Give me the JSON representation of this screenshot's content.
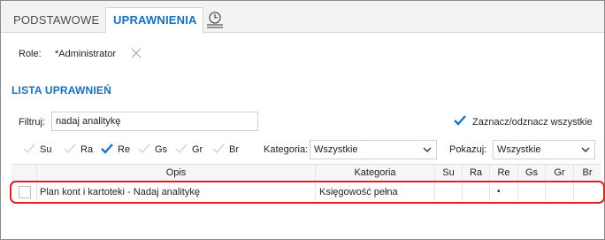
{
  "tabs": [
    {
      "label": "PODSTAWOWE",
      "active": false
    },
    {
      "label": "UPRAWNIENIA",
      "active": true
    },
    {
      "label": "",
      "icon": "history-icon"
    }
  ],
  "role": {
    "label": "Role:",
    "value": "*Administrator",
    "clear_icon": "close-icon"
  },
  "section_title": "LISTA UPRAWNIEŃ",
  "filter": {
    "label": "Filtruj:",
    "value": "nadaj analitykę"
  },
  "toggle_all": {
    "label": "Zaznacz/odznacz wszystkie",
    "checked": true
  },
  "permissions": [
    {
      "code": "Su",
      "checked": false
    },
    {
      "code": "Ra",
      "checked": false
    },
    {
      "code": "Re",
      "checked": true
    },
    {
      "code": "Gs",
      "checked": false
    },
    {
      "code": "Gr",
      "checked": false
    },
    {
      "code": "Br",
      "checked": false
    }
  ],
  "kategoria": {
    "label": "Kategoria:",
    "value": "Wszystkie"
  },
  "pokazuj": {
    "label": "Pokazuj:",
    "value": "Wszystkie"
  },
  "table": {
    "columns": [
      "Opis",
      "Kategoria",
      "Su",
      "Ra",
      "Re",
      "Gs",
      "Gr",
      "Br"
    ],
    "rows": [
      {
        "checked": false,
        "opis": "Plan kont i kartoteki - Nadaj analitykę",
        "kategoria": "Księgowość pełna",
        "su": "",
        "ra": "",
        "re": "•",
        "gs": "",
        "gr": "",
        "br": ""
      }
    ]
  },
  "colors": {
    "accent": "#1a6fb5",
    "check": "#1a73c8",
    "highlight": "#e02020"
  }
}
